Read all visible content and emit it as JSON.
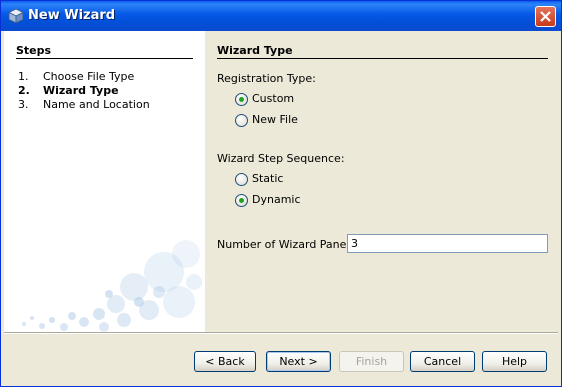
{
  "window": {
    "title": "New Wizard",
    "title_icon": "cube-icon",
    "close_icon": "close-icon"
  },
  "steps": {
    "heading": "Steps",
    "items": [
      {
        "num": "1.",
        "label": "Choose File Type",
        "current": false
      },
      {
        "num": "2.",
        "label": "Wizard Type",
        "current": true
      },
      {
        "num": "3.",
        "label": "Name and Location",
        "current": false
      }
    ]
  },
  "main": {
    "heading": "Wizard Type",
    "registration": {
      "label": "Registration Type:",
      "options": [
        {
          "label": "Custom",
          "selected": true
        },
        {
          "label": "New File",
          "selected": false
        }
      ]
    },
    "sequence": {
      "label": "Wizard Step Sequence:",
      "options": [
        {
          "label": "Static",
          "selected": false
        },
        {
          "label": "Dynamic",
          "selected": true
        }
      ]
    },
    "panels": {
      "label": "Number of Wizard Panels:",
      "value": "3"
    }
  },
  "buttons": {
    "back": "< Back",
    "next": "Next >",
    "finish": "Finish",
    "cancel": "Cancel",
    "help": "Help"
  },
  "colors": {
    "titlebar": "#0558e6",
    "panel_bg": "#ece9d8",
    "radio_dot": "#21a121",
    "bubble": "#a9c8e6"
  }
}
